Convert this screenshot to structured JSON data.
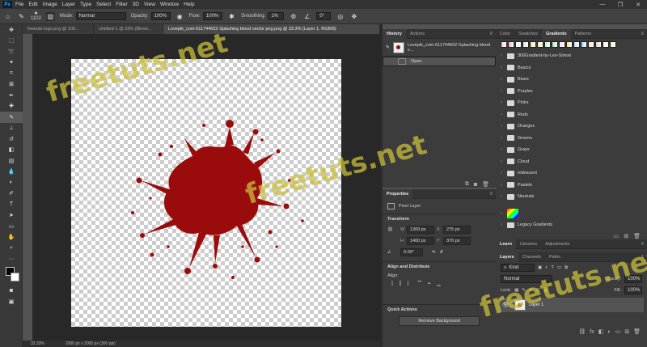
{
  "app": {
    "logo": "Ps"
  },
  "menu": [
    "File",
    "Edit",
    "Image",
    "Layer",
    "Type",
    "Select",
    "Filter",
    "3D",
    "View",
    "Window",
    "Help"
  ],
  "window_controls": [
    "—",
    "❐",
    "✕"
  ],
  "options": {
    "brush_size": "1102",
    "mode_label": "Mode:",
    "mode_value": "Normal",
    "opacity_label": "Opacity:",
    "opacity_value": "100%",
    "flow_label": "Flow:",
    "flow_value": "100%",
    "smoothing_label": "Smoothing:",
    "smoothing_value": "1%",
    "angle_value": "0°"
  },
  "tabs": [
    {
      "label": "freetuts-logo.png @ 100...",
      "active": false
    },
    {
      "label": "Untitled-1 @ 33% (Blend...",
      "active": false
    },
    {
      "label": "Lovepik_com-611744602-Splashing blood vector png.png @ 33.3% (Layer 1, RGB/8)",
      "active": true
    }
  ],
  "status": {
    "zoom": "33.33%",
    "doc_info": "2000 px x 2000 px (300 ppi)"
  },
  "history": {
    "tabs": [
      "History",
      "Actions"
    ],
    "snapshot": "Lovepik_com-611744602-Splashing blood v...",
    "step": "Open"
  },
  "properties": {
    "tab": "Properties",
    "kind": "Pixel Layer",
    "transform_title": "Transform",
    "w_label": "W",
    "w": "1309 px",
    "h_label": "H",
    "h": "1400 px",
    "x_label": "X",
    "x": "275 px",
    "y_label": "Y",
    "y": "376 px",
    "angle": "0.00°",
    "align_title": "Align and Distribute",
    "align_sub": "Align:",
    "quick_title": "Quick Actions",
    "remove_bg": "Remove Background"
  },
  "gradients": {
    "tabs": [
      "Color",
      "Swatches",
      "Gradients",
      "Patterns"
    ],
    "swatch_colors": [
      "#f7c6d9",
      "#f4a8c8",
      "#fff",
      "#e5e5e5",
      "#ffd8a0",
      "#f9e79f",
      "#c8f0c8",
      "#a0f0a0",
      "#fde",
      "#ffe082",
      "#c0e0ff",
      "#8fd3ff",
      "#ffe0b2",
      "#d7ccc8",
      "#fffde7",
      "#f0f4c3"
    ],
    "folders": [
      "300Gradient-by-Leo-Simon",
      "Basics",
      "Blues",
      "Purples",
      "Pinks",
      "Reds",
      "Oranges",
      "Greens",
      "Grays",
      "Cloud",
      "Iridescent",
      "Pastels",
      "Neutrals"
    ],
    "legacy": "Legacy Gradients"
  },
  "layers": {
    "tabs": [
      "Learn",
      "Libraries",
      "Adjustments"
    ],
    "subtabs": [
      "Layers",
      "Channels",
      "Paths"
    ],
    "kind_label": "Kind",
    "blend": "Normal",
    "opacity_label": "Opacity:",
    "opacity": "100%",
    "lock_label": "Lock:",
    "fill_label": "Fill:",
    "fill": "100%",
    "layer_name": "Layer 1"
  },
  "watermark": "freetuts.net",
  "colors": {
    "accent": "#31a8ff",
    "blood": "#9a0c0c"
  }
}
